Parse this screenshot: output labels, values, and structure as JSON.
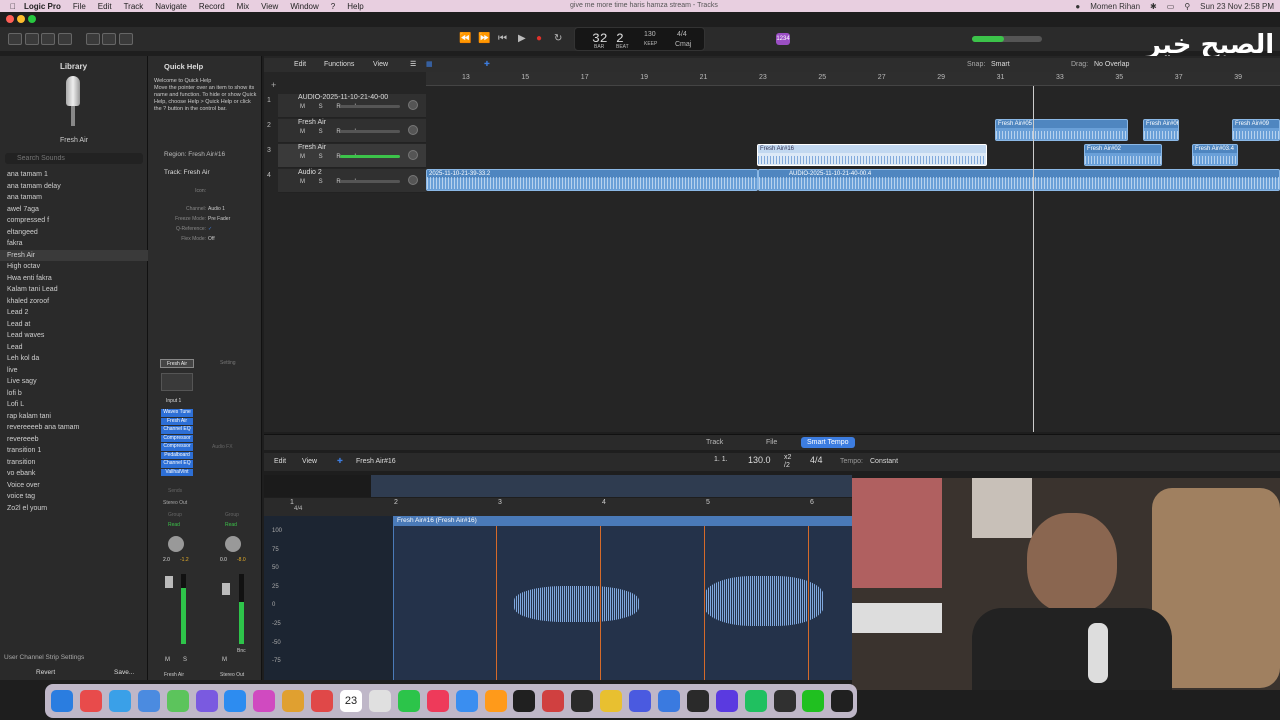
{
  "menubar": {
    "app": "Logic Pro",
    "items": [
      "File",
      "Edit",
      "Track",
      "Navigate",
      "Record",
      "Mix",
      "View",
      "Window",
      "?",
      "Help"
    ],
    "user": "Momen Rihan",
    "datetime": "Sun 23 Nov 2:58 PM"
  },
  "window": {
    "title": "give me more time haris hamza stream - Tracks"
  },
  "lcd": {
    "bar": "32",
    "beat": "2",
    "tempo": "130",
    "tempo_label": "KEEP",
    "sig": "4/4",
    "key": "Cmaj",
    "bar_label": "BAR",
    "beat_label": "BEAT"
  },
  "library": {
    "title": "Library",
    "patch_name": "Fresh Air",
    "search_placeholder": "Search Sounds",
    "patches": [
      "ana tamam 1",
      "ana tamam delay",
      "ana tamam",
      "awel 7aga",
      "compressed f",
      "eltangeed",
      "fakra",
      "Fresh Air",
      "High octav",
      "Hwa enti fakra",
      "Kalam tani Lead",
      "khaled zoroof",
      "Lead 2",
      "Lead at",
      "Lead waves",
      "Lead",
      "Leh kol da",
      "live",
      "Live sagy",
      "lofi b",
      "Lofi L",
      "rap kalam tani",
      "revereeeeb ana tamam",
      "revereeeb",
      "transition 1",
      "transition",
      "vo ebank",
      "Voice over",
      "voice tag",
      "Zo2l el youm"
    ],
    "selected": "Fresh Air",
    "channel_strip_settings": "User Channel Strip Settings",
    "revert": "Revert",
    "save": "Save..."
  },
  "quickhelp": {
    "title": "Quick Help",
    "welcome": "Welcome to Quick Help",
    "body": "Move the pointer over an item to show its name and function. To hide or show Quick Help, choose Help > Quick Help or click the ? button in the control bar.",
    "region_label": "Region:",
    "region_name": "Fresh Air#16",
    "track_label": "Track:",
    "track_name": "Fresh Air",
    "icon_label": "Icon:",
    "channel_label": "Channel:",
    "channel_val": "Audio 1",
    "freeze_label": "Freeze Mode:",
    "freeze_val": "Pre Fader",
    "qref_label": "Q-Reference:",
    "flex_label": "Flex Mode:",
    "flex_val": "Off"
  },
  "strip": {
    "name1": "Fresh Air",
    "setting": "Setting",
    "input": "Input 1",
    "plugins": [
      "Waves Tune",
      "Fresh Air",
      "Channel EQ",
      "Compressor",
      "Compressor",
      "Pedalboard",
      "Channel EQ",
      "VallhalVint"
    ],
    "audio_fx": "Audio FX",
    "output": "Stereo Out",
    "group": "Group",
    "read": "Read",
    "val1": "2.0",
    "val2": "-1.2",
    "val3": "0.0",
    "val4": "-8.0",
    "m": "M",
    "s": "S",
    "bnc": "Bnc",
    "bottom1": "Fresh Air",
    "bottom2": "Stereo Out",
    "sends": "Sends"
  },
  "tracks_toolbar": {
    "edit": "Edit",
    "functions": "Functions",
    "view": "View",
    "snap_label": "Snap:",
    "snap_val": "Smart",
    "drag_label": "Drag:",
    "drag_val": "No Overlap"
  },
  "ruler": [
    "13",
    "15",
    "17",
    "19",
    "21",
    "23",
    "25",
    "27",
    "29",
    "31",
    "33",
    "35",
    "37",
    "39"
  ],
  "tracks": [
    {
      "num": "1",
      "name": "AUDIO-2025-11-10-21-40-00"
    },
    {
      "num": "2",
      "name": "Fresh Air"
    },
    {
      "num": "3",
      "name": "Fresh Air"
    },
    {
      "num": "4",
      "name": "Audio 2"
    }
  ],
  "msri": "M S R I",
  "regions": {
    "r1": "Fresh Air#05",
    "r2": "Fresh Air#06",
    "r3": "Fresh Air#09",
    "r4": "Fresh Air#16",
    "r5": "Fresh Air#02",
    "r6": "Fresh Air#03.4",
    "r7": "2025-11-10-21-39-33.2",
    "r8": "AUDIO-2025-11-10-21-40-00.4"
  },
  "editor": {
    "tab_track": "Track",
    "tab_file": "File",
    "tab_smart": "Smart Tempo",
    "edit": "Edit",
    "view": "View",
    "region": "Fresh Air#16",
    "pos": "1. 1.",
    "tempo": "130.0",
    "mult": "x2",
    "div": "/2",
    "sig": "4/4",
    "tempo_label": "Tempo:",
    "tempo_val": "Constant",
    "ruler": [
      "1",
      "2",
      "3",
      "4",
      "5",
      "6"
    ],
    "sig_mark": "4/4",
    "region_hdr": "Fresh Air#16 (Fresh Air#16)",
    "ylabels": [
      "100",
      "75",
      "50",
      "25",
      "0",
      "-25",
      "-50",
      "-75"
    ]
  },
  "watermark": "الصبح خير",
  "dock": {
    "calendar_day": "23"
  }
}
